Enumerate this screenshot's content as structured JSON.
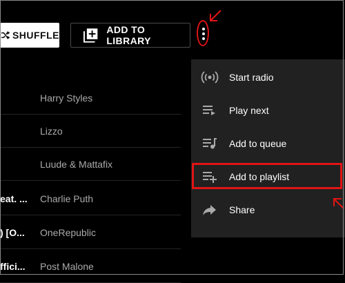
{
  "toolbar": {
    "shuffle_label": "SHUFFLE",
    "add_to_library_label": "ADD TO LIBRARY"
  },
  "tracks": [
    {
      "title": "",
      "artist": "Harry Styles"
    },
    {
      "title": "",
      "artist": "Lizzo"
    },
    {
      "title": "",
      "artist": "Luude & Mattafix"
    },
    {
      "title": "eat. ...",
      "artist": "Charlie Puth"
    },
    {
      "title": ") [O...",
      "artist": "OneRepublic"
    },
    {
      "title": "ffici...",
      "artist": "Post Malone"
    }
  ],
  "menu": {
    "items": [
      {
        "label": "Start radio",
        "icon": "radio-icon"
      },
      {
        "label": "Play next",
        "icon": "play-next-icon"
      },
      {
        "label": "Add to queue",
        "icon": "add-to-queue-icon"
      },
      {
        "label": "Add to playlist",
        "icon": "add-to-playlist-icon"
      },
      {
        "label": "Share",
        "icon": "share-icon"
      }
    ]
  },
  "colors": {
    "background": "#000000",
    "menu_background": "#212121",
    "annotation_red": "#e11414",
    "secondary_text": "#aaaaaa"
  }
}
